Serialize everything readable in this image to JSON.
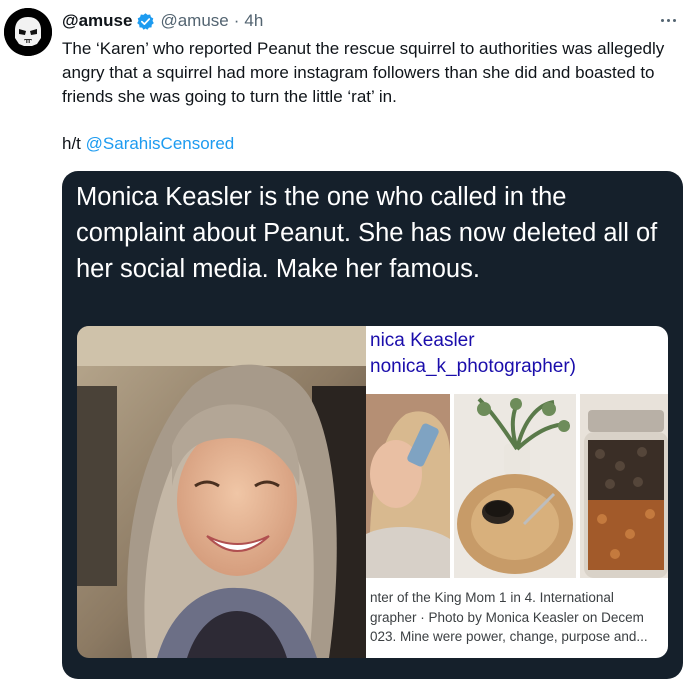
{
  "tweet": {
    "display_name": "@amuse",
    "handle": "@amuse",
    "separator": "·",
    "time": "4h",
    "text": "The ‘Karen’ who reported Peanut the rescue squirrel to authorities was allegedly angry that a squirrel had more instagram followers than she did and boasted to friends she was going to turn the little ‘rat’ in.",
    "hat_tip_prefix": "h/t",
    "hat_tip_mention": "@SarahisCensored"
  },
  "icons": {
    "avatar": "stormtrooper-avatar",
    "verified": "verified-badge-icon",
    "more": "more-options-icon"
  },
  "media": {
    "caption": "Monica Keasler is the one who called in the complaint about Peanut. She has now deleted all of her social media. Make her famous.",
    "search_result": {
      "name": "nica Keasler",
      "handle": "nonica_k_photographer)",
      "caption_lines": [
        "nter of the King Mom 1 in 4. International",
        "grapher · Photo by Monica Keasler on Decem",
        "023. Mine were power, change, purpose and..."
      ]
    }
  },
  "colors": {
    "link": "#1d9bf0",
    "card_background": "#15202b",
    "verified_badge": "#1d9bf0",
    "search_link": "#1a0dab"
  }
}
